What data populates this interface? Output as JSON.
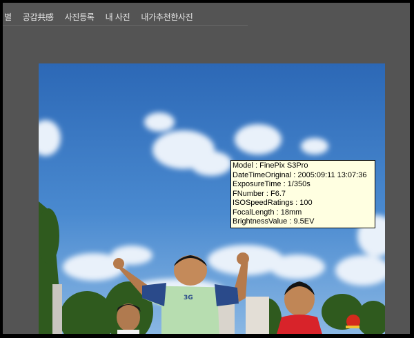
{
  "nav": {
    "items": [
      "별",
      "공감共感",
      "사진등록",
      "내 사진",
      "내가추천한사진"
    ]
  },
  "photo": {
    "shirt_text": "3G"
  },
  "exif": {
    "lines": [
      "Model : FinePix S3Pro",
      "DateTimeOriginal : 2005:09:11 13:07:36",
      "ExposureTime : 1/350s",
      "FNumber : F6.7",
      "ISOSpeedRatings : 100",
      "FocalLength : 18mm",
      "BrightnessValue : 9.5EV"
    ]
  },
  "colors": {
    "background": "#545454",
    "tooltip_bg": "#ffffe1",
    "sky_top": "#2f6bb8",
    "sky_bottom": "#7fb0e2"
  }
}
